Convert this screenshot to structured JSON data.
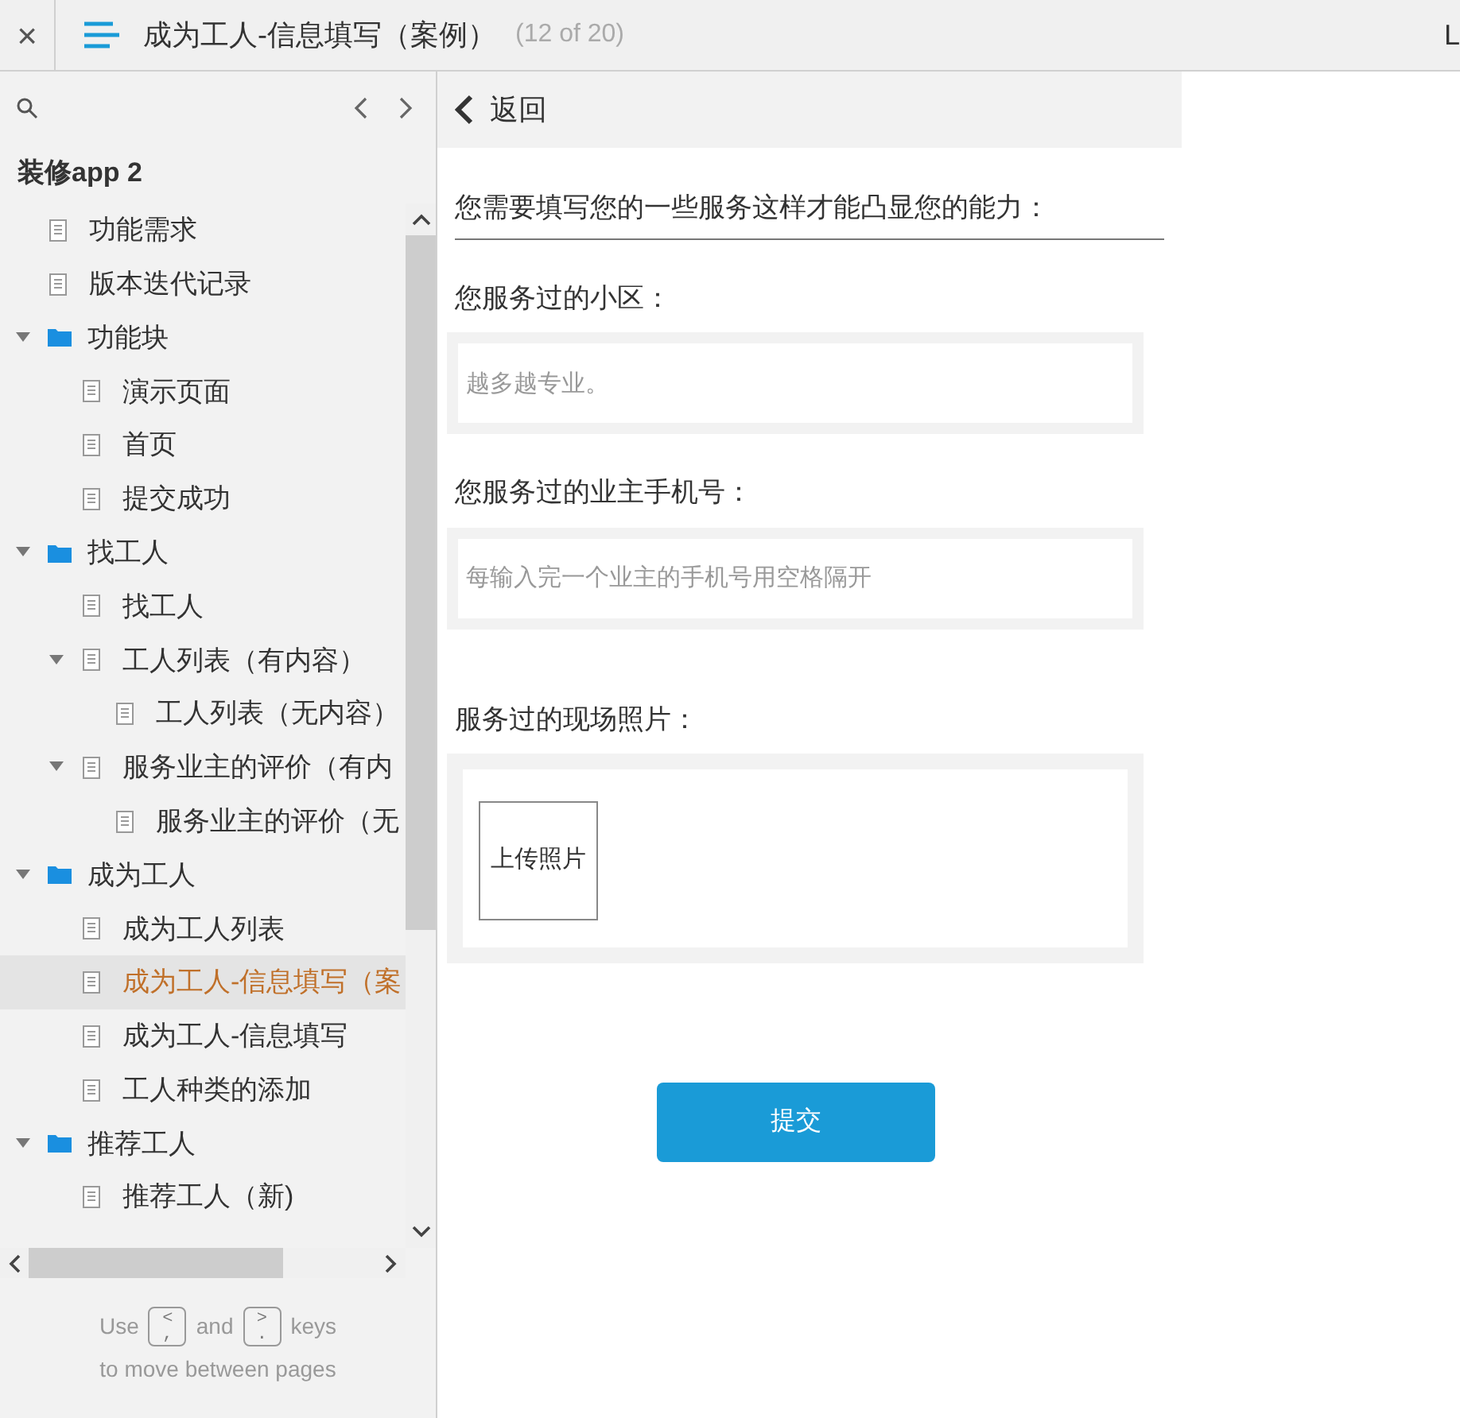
{
  "header": {
    "close": "×",
    "title": "成为工人-信息填写（案例）",
    "page_count": "(12 of 20)",
    "edge_text": "L"
  },
  "sidebar": {
    "project": "装修app 2",
    "tree": [
      {
        "kind": "page",
        "label": "功能需求",
        "selected": false
      },
      {
        "kind": "page",
        "label": "版本迭代记录",
        "selected": false
      },
      {
        "kind": "folder",
        "label": "功能块",
        "expanded": true,
        "selected": false,
        "children": [
          {
            "kind": "page",
            "label": "演示页面",
            "selected": false
          },
          {
            "kind": "page",
            "label": "首页",
            "selected": false
          },
          {
            "kind": "page",
            "label": "提交成功",
            "selected": false
          }
        ]
      },
      {
        "kind": "folder",
        "label": "找工人",
        "expanded": true,
        "selected": false,
        "children": [
          {
            "kind": "page",
            "label": "找工人",
            "selected": false
          },
          {
            "kind": "page",
            "label": "工人列表（有内容）",
            "expanded": true,
            "selected": false,
            "children": [
              {
                "kind": "page",
                "label": "工人列表（无内容）",
                "selected": false
              }
            ]
          },
          {
            "kind": "page",
            "label": "服务业主的评价（有内",
            "expanded": true,
            "selected": false,
            "children": [
              {
                "kind": "page",
                "label": "服务业主的评价（无",
                "selected": false
              }
            ]
          }
        ]
      },
      {
        "kind": "folder",
        "label": "成为工人",
        "expanded": true,
        "selected": false,
        "children": [
          {
            "kind": "page",
            "label": "成为工人列表",
            "selected": false
          },
          {
            "kind": "page",
            "label": "成为工人-信息填写（案",
            "selected": true
          },
          {
            "kind": "page",
            "label": "成为工人-信息填写",
            "selected": false
          },
          {
            "kind": "page",
            "label": "工人种类的添加",
            "selected": false
          }
        ]
      },
      {
        "kind": "folder",
        "label": "推荐工人",
        "expanded": true,
        "selected": false,
        "children": [
          {
            "kind": "page",
            "label": "推荐工人（新)",
            "selected": false
          }
        ]
      }
    ],
    "footer": {
      "use": "Use",
      "keys": [
        {
          "top": "<",
          "bottom": ","
        },
        {
          "top": ">",
          "bottom": "."
        }
      ],
      "and": "and",
      "keys_word": "keys",
      "line2": "to move between pages"
    }
  },
  "content": {
    "back": "返回",
    "intro": "您需要填写您的一些服务这样才能凸显您的能力：",
    "fields": [
      {
        "label": "您服务过的小区：",
        "placeholder": "越多越专业。"
      },
      {
        "label": "您服务过的业主手机号：",
        "placeholder": "每输入完一个业主的手机号用空格隔开"
      }
    ],
    "photos_label": "服务过的现场照片：",
    "upload": "上传照片",
    "submit": "提交"
  }
}
